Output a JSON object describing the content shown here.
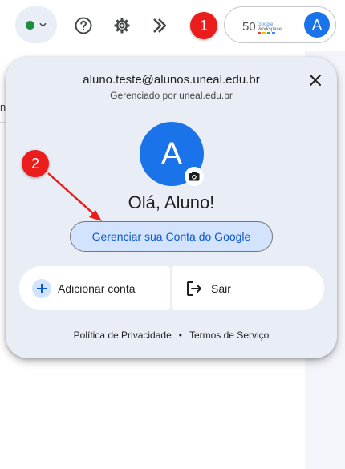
{
  "topbar": {
    "status_color": "#1e8e3e",
    "icons": [
      "chevron-down-icon",
      "help-icon",
      "settings-icon",
      "gemini-icon"
    ],
    "workspace_logo": "Google Workspace"
  },
  "account": {
    "avatar_letter": "A",
    "email": "aluno.teste@alunos.uneal.edu.br",
    "managed_by": "Gerenciado por uneal.edu.br",
    "greeting": "Olá, Aluno!",
    "manage_label": "Gerenciar sua Conta do Google",
    "add_account_label": "Adicionar conta",
    "sign_out_label": "Sair",
    "privacy_label": "Política de Privacidade",
    "separator": "•",
    "terms_label": "Termos de Serviço"
  },
  "annotations": {
    "step1": "1",
    "step2": "2",
    "color": "#ea1c1c"
  },
  "background": {
    "fragment": "n"
  }
}
